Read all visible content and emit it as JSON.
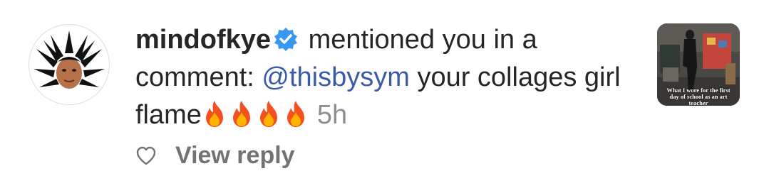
{
  "notification": {
    "username": "mindofkye",
    "message": " mentioned you in a comment: ",
    "mention": "@thisbysym",
    "comment_text": " your collages girl flame",
    "emoji": [
      "fire",
      "fire",
      "fire",
      "fire"
    ],
    "time": "5h",
    "verified": true
  },
  "actions": {
    "view_reply": "View reply"
  },
  "thumbnail": {
    "caption": "What I wore for the first day of school as an art teacher"
  },
  "colors": {
    "mention": "#3b5ba8",
    "verified_badge": "#3897f0",
    "text": "#262626",
    "muted": "#8e8e8e"
  }
}
